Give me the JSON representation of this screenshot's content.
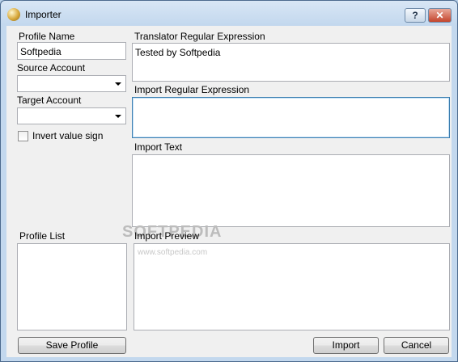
{
  "window": {
    "title": "Importer",
    "help_label": "?",
    "close_label": "✕"
  },
  "left": {
    "profile_name_label": "Profile Name",
    "profile_name_value": "Softpedia",
    "source_account_label": "Source Account",
    "source_account_value": "",
    "target_account_label": "Target Account",
    "target_account_value": "",
    "invert_label": "Invert value sign",
    "invert_checked": false,
    "profile_list_label": "Profile List",
    "save_button": "Save Profile"
  },
  "right": {
    "translator_label": "Translator Regular Expression",
    "translator_value": "Tested by Softpedia",
    "import_regex_label": "Import Regular Expression",
    "import_regex_value": "",
    "import_text_label": "Import Text",
    "import_text_value": "",
    "import_preview_label": "Import Preview",
    "import_button": "Import",
    "cancel_button": "Cancel"
  },
  "watermark": {
    "large": "SOFTPEDIA",
    "small": "www.softpedia.com"
  },
  "colors": {
    "accent_focus": "#3c7fb1",
    "client_bg": "#f0f0f0",
    "close_red": "#c4442c"
  }
}
